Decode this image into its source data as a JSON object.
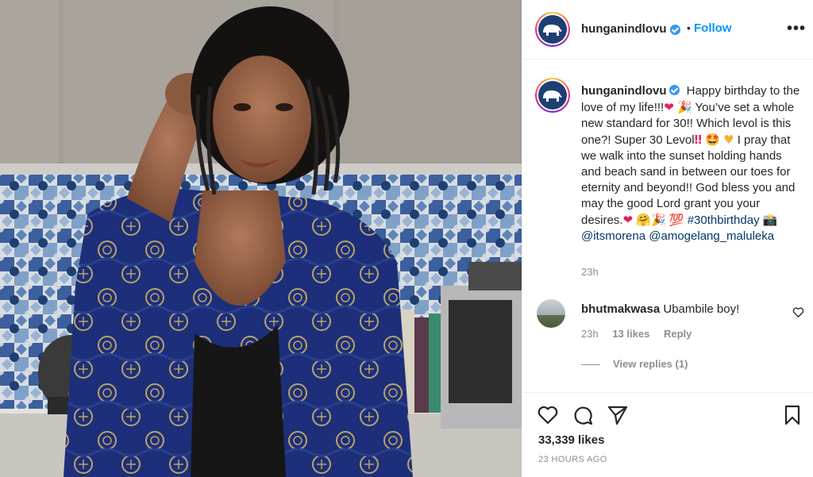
{
  "post": {
    "author": "hunganindlovu",
    "follow_label": "Follow",
    "separator": "•",
    "more_label": "•••"
  },
  "caption": {
    "username": "hunganindlovu",
    "text_1": "Happy birthday to the love of my life!!!",
    "text_2": "You’ve set a whole new standard for 30!! Which levol is this one?! Super 30 Levol",
    "text_3": "I pray that we walk into the sunset holding hands and beach sand in between our toes for eternity and beyond!! God bless you and may the good Lord grant you your desires.",
    "hashtag": "#30thbirthday",
    "mention_1": "@itsmorena",
    "mention_2": "@amogelang_maluleka",
    "time": "23h"
  },
  "emoji": {
    "heart": "❤",
    "party": "🎉",
    "double_bang": "‼",
    "star_eyes": "🤩",
    "yellow_heart": "♥",
    "hug": "🤗",
    "hundred": "💯",
    "camera": "📸"
  },
  "comment": {
    "username": "bhutmakwasa",
    "text": "Ubambile boy!",
    "time": "23h",
    "likes": "13 likes",
    "reply_label": "Reply",
    "view_replies": "View replies (1)"
  },
  "footer": {
    "likes": "33,339 likes",
    "posted_ago": "23 HOURS AGO"
  },
  "colors": {
    "accent_blue": "#0095f6",
    "verified_blue": "#3897f0",
    "text_primary": "#262626",
    "text_secondary": "#8e8e8e",
    "border": "#efefef",
    "link": "#00376b",
    "robe_blue": "#1d2f7a"
  },
  "icons": [
    "elephant-logo-icon",
    "verified-badge-icon",
    "more-options-icon",
    "heart-icon",
    "comment-icon",
    "share-icon",
    "bookmark-icon"
  ]
}
